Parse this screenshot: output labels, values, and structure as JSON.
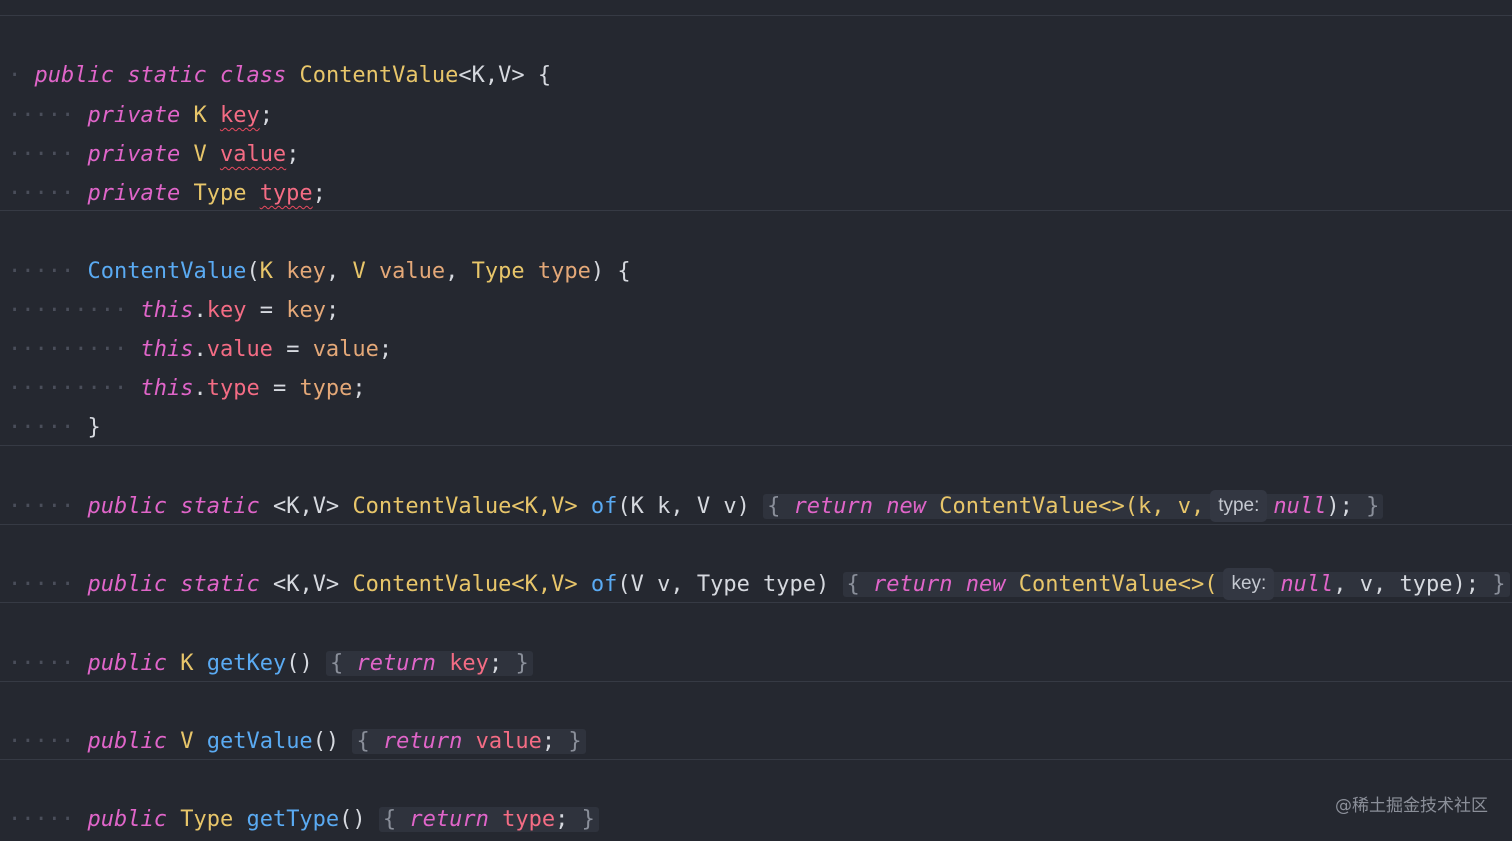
{
  "editor": {
    "class_decl": {
      "kw_public": "public",
      "kw_static": "static",
      "kw_class": "class",
      "name": "ContentValue",
      "generics": "<K,V>",
      "open": "{"
    },
    "fields": [
      {
        "kw": "private",
        "type": "K",
        "name": "key",
        "semi": ";"
      },
      {
        "kw": "private",
        "type": "V",
        "name": "value",
        "semi": ";"
      },
      {
        "kw": "private",
        "type": "Type",
        "name": "type",
        "semi": ";"
      }
    ],
    "constructor": {
      "name": "ContentValue",
      "signature_open": "(",
      "p1_type": "K",
      "p1_name": "key",
      "p2_type": "V",
      "p2_name": "value",
      "p3_type": "Type",
      "p3_name": "type",
      "signature_close": ")",
      "open": "{",
      "assigns": [
        {
          "this": "this",
          "field": "key",
          "value": "key"
        },
        {
          "this": "this",
          "field": "value",
          "value": "value"
        },
        {
          "this": "this",
          "field": "type",
          "value": "type"
        }
      ],
      "close": "}"
    },
    "of1": {
      "kw_public": "public",
      "kw_static": "static",
      "generics": "<K,V>",
      "ret": "ContentValue<K,V>",
      "name": "of",
      "params": "(K k, V v)",
      "kw_return": "return",
      "kw_new": "new",
      "ctor": "ContentValue<>(k, v,",
      "hint": "type:",
      "null": "null",
      "end": ");"
    },
    "of2": {
      "kw_public": "public",
      "kw_static": "static",
      "generics": "<K,V>",
      "ret": "ContentValue<K,V>",
      "name": "of",
      "params": "(V v, Type type)",
      "kw_return": "return",
      "kw_new": "new",
      "ctor": "ContentValue<>(",
      "hint": "key:",
      "null": "null",
      "end": ", v, type);"
    },
    "getters": [
      {
        "kw": "public",
        "type": "K",
        "name": "getKey",
        "parens": "()",
        "kw_return": "return",
        "field": "key"
      },
      {
        "kw": "public",
        "type": "V",
        "name": "getValue",
        "parens": "()",
        "kw_return": "return",
        "field": "value"
      },
      {
        "kw": "public",
        "type": "Type",
        "name": "getType",
        "parens": "()",
        "kw_return": "return",
        "field": "type"
      }
    ],
    "class_close": "}"
  },
  "watermark": "@稀土掘金技术社区",
  "colors": {
    "background": "#252830",
    "keyword": "#e065c9",
    "function": "#5aaaf2",
    "type": "#e8c66a",
    "field": "#f46c84",
    "parameter": "#e4a878"
  }
}
